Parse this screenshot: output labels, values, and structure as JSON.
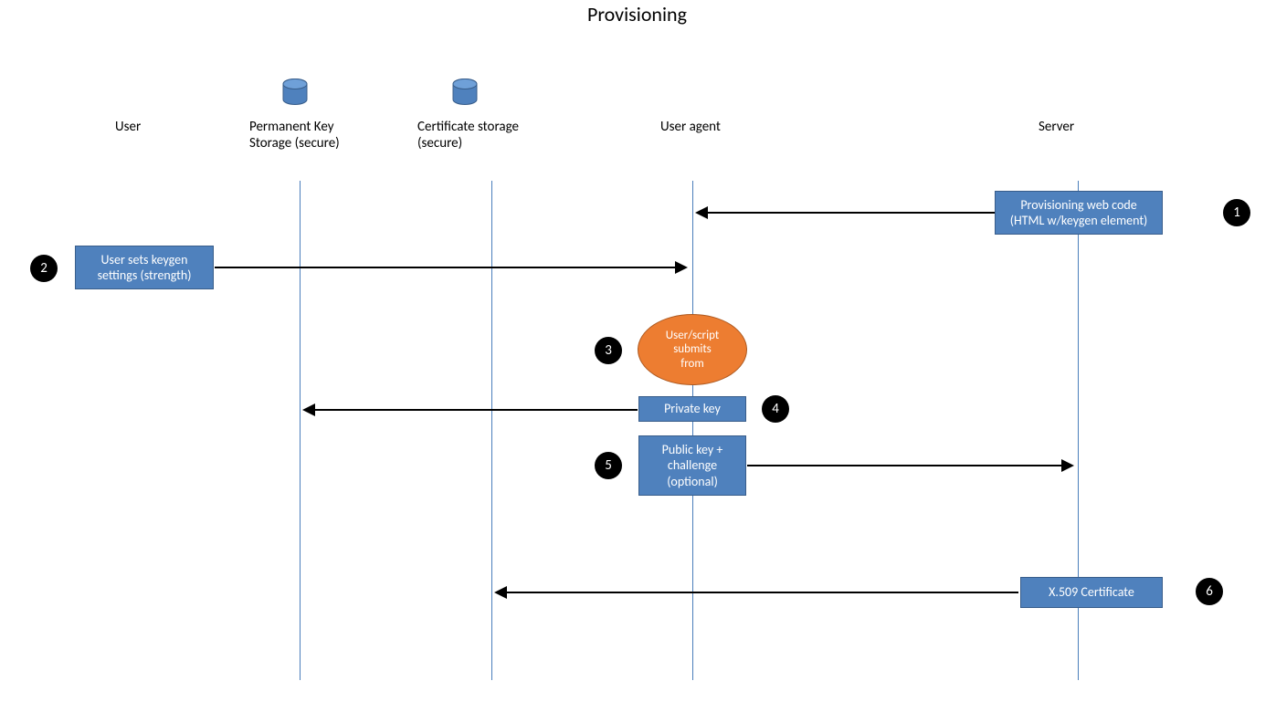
{
  "title": "Provisioning",
  "lanes": {
    "user": "User",
    "pks": "Permanent Key\nStorage (secure)",
    "cs": "Certificate storage\n(secure)",
    "ua": "User agent",
    "server": "Server"
  },
  "steps": {
    "s1": {
      "num": "1",
      "label": "Provisioning web code\n(HTML w/keygen element)"
    },
    "s2": {
      "num": "2",
      "label": "User sets keygen\nsettings (strength)"
    },
    "s3": {
      "num": "3",
      "label": "User/script\nsubmits\nfrom"
    },
    "s4": {
      "num": "4",
      "label": "Private key"
    },
    "s5": {
      "num": "5",
      "label": "Public key +\nchallenge\n(optional)"
    },
    "s6": {
      "num": "6",
      "label": "X.509 Certificate"
    }
  }
}
